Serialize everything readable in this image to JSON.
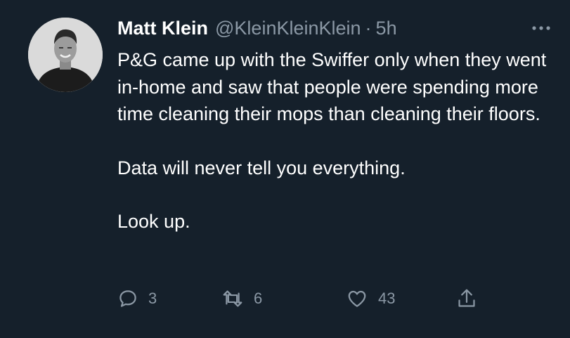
{
  "tweet": {
    "author_name": "Matt Klein",
    "handle": "@KleinKleinKlein",
    "separator": "·",
    "time": "5h",
    "paragraphs": [
      "P&G came up with the Swiffer only when they went in-home and saw that people were spending more time cleaning their mops than cleaning their floors.",
      "Data will never tell you everything.",
      "Look up."
    ],
    "actions": {
      "reply_count": "3",
      "retweet_count": "6",
      "like_count": "43"
    },
    "icons": {
      "more": "more-horizontal-icon",
      "reply": "reply-icon",
      "retweet": "retweet-icon",
      "like": "heart-icon",
      "share": "share-icon"
    },
    "colors": {
      "background": "#15202b",
      "text": "#ffffff",
      "secondary": "#8b98a5"
    }
  }
}
